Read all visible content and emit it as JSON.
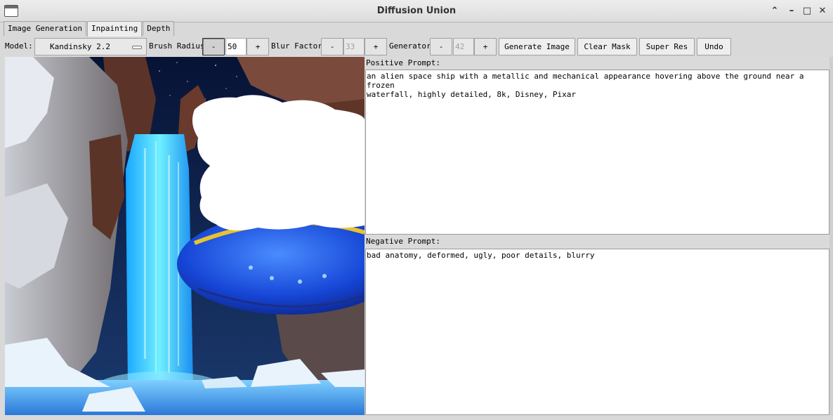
{
  "window": {
    "title": "Diffusion Union"
  },
  "tabs": [
    {
      "label": "Image Generation"
    },
    {
      "label": "Inpainting"
    },
    {
      "label": "Depth"
    }
  ],
  "toolbar": {
    "model_label": "Model:",
    "model_value": "Kandinsky 2.2",
    "brush_radius_label": "Brush Radius",
    "brush_radius_value": "50",
    "blur_factor_label": "Blur Factor",
    "blur_factor_value": "33",
    "generator_label": "Generator",
    "generator_value": "42",
    "minus": "-",
    "plus": "+",
    "generate_label": "Generate Image",
    "clear_mask_label": "Clear Mask",
    "super_res_label": "Super Res",
    "undo_label": "Undo"
  },
  "prompts": {
    "positive_label": "Positive Prompt:",
    "positive_text": "an alien space ship with a metallic and mechanical appearance hovering above the ground near a frozen\nwaterfall, highly detailed, 8k, Disney, Pixar",
    "negative_label": "Negative Prompt:",
    "negative_text": "bad anatomy, deformed, ugly, poor details, blurry"
  },
  "colors": {
    "accent_blue": "#1f5fe8",
    "waterfall": "#3ad3ff",
    "rock": "#7a4a3c",
    "snow": "#e9f3fb"
  }
}
